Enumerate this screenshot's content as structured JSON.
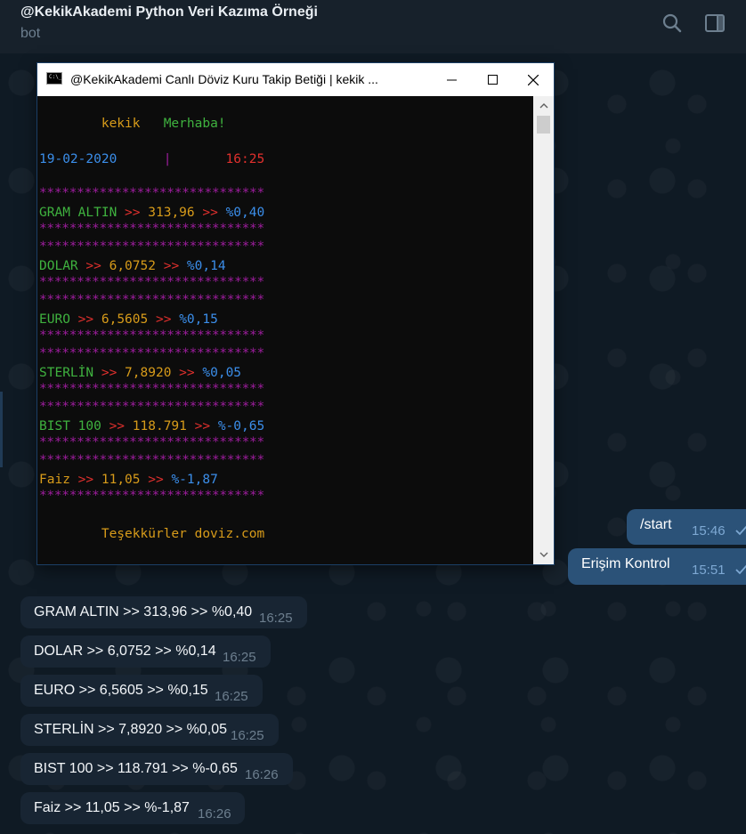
{
  "header": {
    "title": "@KekikAkademi Python Veri Kazıma Örneği",
    "subtitle": "bot",
    "search_icon": "search-icon",
    "sidebar_icon": "sidebar-toggle-icon"
  },
  "terminal": {
    "window_title": "@KekikAkademi Canlı Döviz Kuru Takip Betiği | kekik ...",
    "icon_text": "C:\\_",
    "greeting_name": "kekik",
    "greeting": "Merhaba!",
    "date": "19-02-2020",
    "separator": "|",
    "time": "16:25",
    "stars": "******************************",
    "rows": [
      {
        "name": "GRAM ALTIN",
        "arrow1": ">>",
        "value": "313,96",
        "arrow2": ">>",
        "change": "%0,40"
      },
      {
        "name": "DOLAR",
        "arrow1": ">>",
        "value": "6,0752",
        "arrow2": ">>",
        "change": "%0,14"
      },
      {
        "name": "EURO",
        "arrow1": ">>",
        "value": "6,5605",
        "arrow2": ">>",
        "change": "%0,15"
      },
      {
        "name": "STERLİN",
        "arrow1": ">>",
        "value": "7,8920",
        "arrow2": ">>",
        "change": "%0,05"
      },
      {
        "name": "BIST 100",
        "arrow1": ">>",
        "value": "118.791",
        "arrow2": ">>",
        "change": "%-0,65"
      },
      {
        "name": "Faiz",
        "arrow1": ">>",
        "value": "11,05",
        "arrow2": ">>",
        "change": "%-1,87"
      }
    ],
    "thanks": "Teşekkürler doviz.com"
  },
  "outgoing": [
    {
      "text": "/start",
      "time": "15:46"
    },
    {
      "text": "Erişim Kontrol",
      "time": "15:51"
    }
  ],
  "incoming": [
    {
      "text": "GRAM ALTIN >> 313,96 >> %0,40",
      "time": "16:25"
    },
    {
      "text": "DOLAR >> 6,0752 >> %0,14",
      "time": "16:25"
    },
    {
      "text": "EURO >> 6,5605 >> %0,15",
      "time": "16:25"
    },
    {
      "text": "STERLİN >> 7,8920 >> %0,05",
      "time": "16:25"
    },
    {
      "text": "BIST 100 >> 118.791 >> %-0,65",
      "time": "16:26"
    },
    {
      "text": "Faiz >> 11,05 >> %-1,87",
      "time": "16:26"
    }
  ],
  "colors": {
    "header_bg": "#17212b",
    "outgoing_bubble": "#2b5278",
    "incoming_bubble": "#182533",
    "terminal_orange": "#d79b1a",
    "terminal_green": "#3fb23f",
    "terminal_red": "#e0302d",
    "terminal_blue": "#3b8eea",
    "terminal_purple": "#9d1d9d"
  }
}
